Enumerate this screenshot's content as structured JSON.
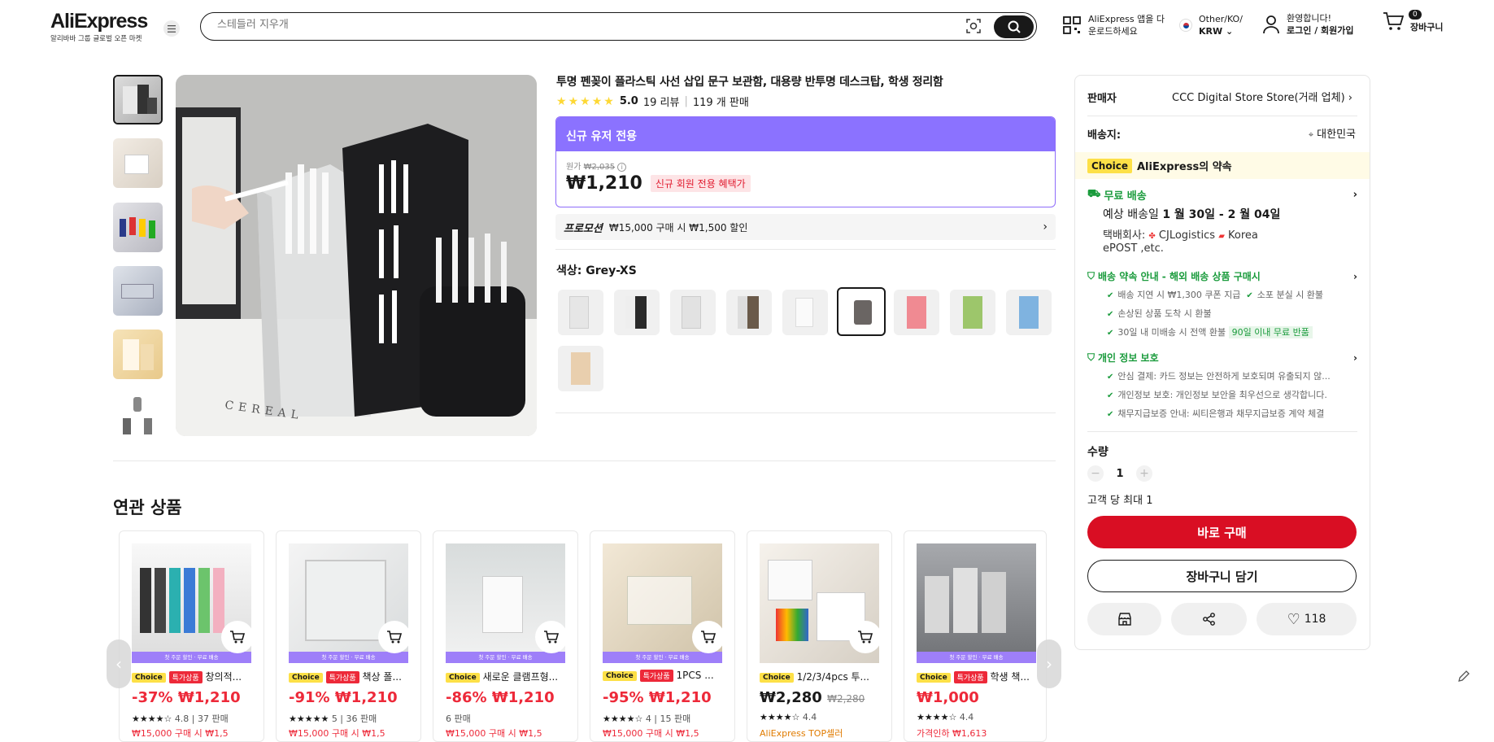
{
  "header": {
    "logo": "AliExpress",
    "logo_sub": "알리바바 그룹 글로벌 오픈 마켓",
    "search_placeholder": "스테들러 지우개",
    "app_promo_line1": "AliExpress 앱을 다",
    "app_promo_line2": "운로드하세요",
    "region_line1": "Other/KO/",
    "region_line2": "KRW",
    "account_line1": "환영합니다!",
    "account_line2": "로그인 / 회원가입",
    "cart_count": "0",
    "cart_label": "장바구니"
  },
  "product": {
    "title": "투명 펜꽂이 플라스틱 사선 삽입 문구 보관함, 대용량 반투명 데스크탑, 학생 정리함",
    "rating": "5.0",
    "reviews": "19 리뷰",
    "sold": "119 개 판매",
    "promo_head": "신규 유저 전용",
    "original_label": "원가",
    "original_price": "₩2,035",
    "price": "₩1,210",
    "new_user_badge": "신규 회원 전용 혜택가",
    "promotion_label": "프로모션",
    "promotion_text": "₩15,000 구매 시 ₩1,500 할인",
    "color_label": "색상: Grey-XS",
    "related_title": "연관 상품"
  },
  "sidebar": {
    "seller_label": "판매자",
    "seller_name": "CCC Digital Store Store(거래 업체)",
    "ship_to_label": "배송지:",
    "ship_to": "대한민국",
    "choice_tag": "Choice",
    "choice_promise": "AliExpress의 약속",
    "free_shipping": "무료 배송",
    "delivery_prefix": "예상 배송일",
    "delivery_dates": "1 월 30일 - 2 월 04일",
    "carrier_label": "택배회사:",
    "carrier_1": "CJLogistics",
    "carrier_2": "Korea",
    "carrier_3": "ePOST ,etc.",
    "guarantee_title": "배송 약속 안내 - 해외 배송 상품 구매시",
    "guarantee_items": [
      "배송 지연 시 ₩1,300 쿠폰 지급",
      "소포 분실 시 환불",
      "손상된 상품 도착 시 환불",
      "30일 내 미배송 시 전액 환불"
    ],
    "return_badge": "90일 이내 무료 반품",
    "privacy_title": "개인 정보 보호",
    "privacy_items": [
      "안심 결제: 카드 정보는 안전하게 보호되며 유출되지 않...",
      "개인정보 보호: 개인정보 보안을 최우선으로 생각합니다.",
      "채무지급보증 안내: 씨티은행과 채무지급보증 계약 체결"
    ],
    "qty_label": "수량",
    "qty_value": "1",
    "qty_limit": "고객 당 최대 1",
    "buy_now": "바로 구매",
    "add_cart": "장바구니 담기",
    "wishlist_count": "118"
  },
  "related": [
    {
      "tag2": "특가상품",
      "name": "창의적...",
      "discount": "-37%",
      "price": "₩1,210",
      "stars": "4.8",
      "sold": "37 판매",
      "promo": "₩15,000 구매 시 ₩1,5"
    },
    {
      "tag2": "특가상품",
      "name": "책상 폴...",
      "discount": "-91%",
      "price": "₩1,210",
      "stars": "5",
      "sold": "36 판매",
      "promo": "₩15,000 구매 시 ₩1,5"
    },
    {
      "tag2": "",
      "name": "새로운 클램프형...",
      "discount": "-86%",
      "price": "₩1,210",
      "stars": "",
      "sold": "6 판매",
      "promo": "₩15,000 구매 시 ₩1,5"
    },
    {
      "tag2": "특가상품",
      "name": "1PCS ...",
      "discount": "-95%",
      "price": "₩1,210",
      "stars": "4",
      "sold": "15 판매",
      "promo": "₩15,000 구매 시 ₩1,5"
    },
    {
      "tag2": "",
      "name": "1/2/3/4pcs 투...",
      "discount": "",
      "price": "₩2,280",
      "old": "₩2,280",
      "stars": "4.4",
      "sold": "",
      "promo": "AliExpress TOP셀러"
    },
    {
      "tag2": "특가상품",
      "name": "학생 책...",
      "discount": "",
      "price": "₩1,000",
      "stars": "4.4",
      "sold": "",
      "promo": "가격인하 ₩1,613"
    }
  ],
  "related_band": "첫 주문 할인 · 무료 배송",
  "choice_label": "Choice"
}
